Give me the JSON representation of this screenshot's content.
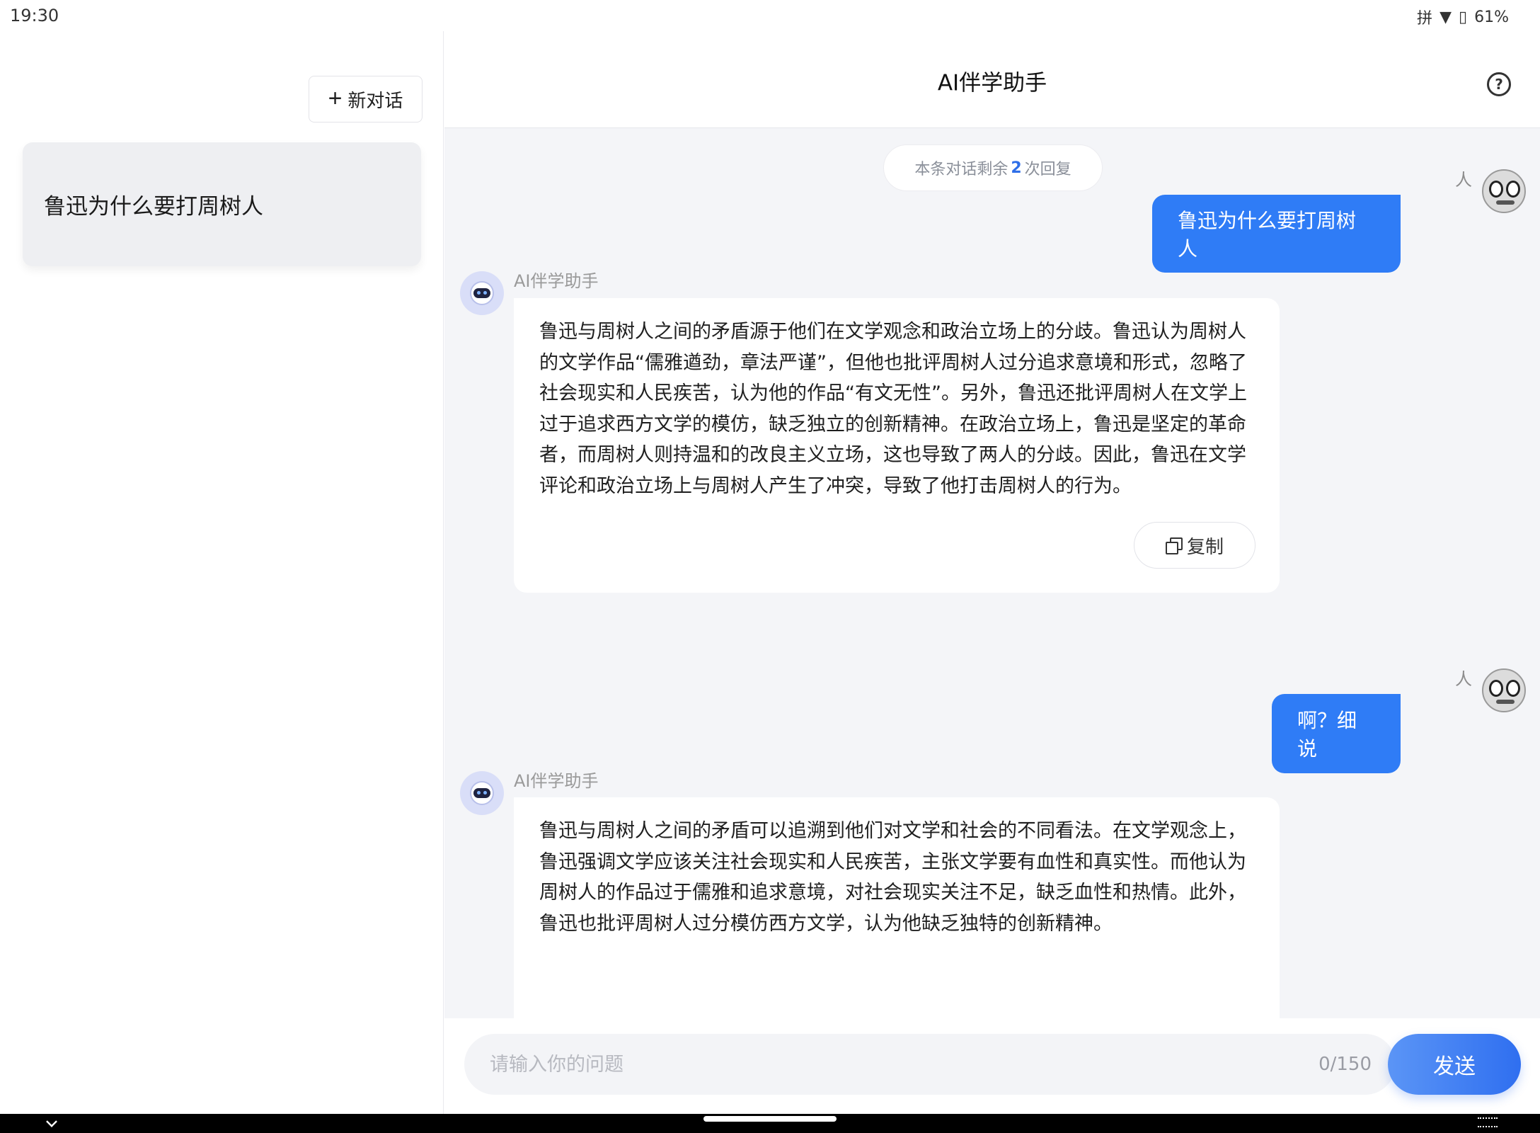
{
  "status_bar": {
    "time": "19:30",
    "ime": "拼",
    "battery": "61%"
  },
  "sidebar": {
    "new_chat_label": "新对话",
    "history": [
      {
        "title": "鲁迅为什么要打周树人"
      }
    ]
  },
  "header": {
    "title": "AI伴学助手"
  },
  "chat": {
    "remaining_prefix": "本条对话剩余",
    "remaining_count": "2",
    "remaining_suffix": "次回复",
    "user_name": "人",
    "assistant_name": "AI伴学助手",
    "messages": [
      {
        "role": "user",
        "text": "鲁迅为什么要打周树人"
      },
      {
        "role": "assistant",
        "text": "鲁迅与周树人之间的矛盾源于他们在文学观念和政治立场上的分歧。鲁迅认为周树人的文学作品“儒雅遒劲，章法严谨”，但他也批评周树人过分追求意境和形式，忽略了社会现实和人民疾苦，认为他的作品“有文无性”。另外，鲁迅还批评周树人在文学上过于追求西方文学的模仿，缺乏独立的创新精神。在政治立场上，鲁迅是坚定的革命者，而周树人则持温和的改良主义立场，这也导致了两人的分歧。因此，鲁迅在文学评论和政治立场上与周树人产生了冲突，导致了他打击周树人的行为。",
        "copy_label": "复制"
      },
      {
        "role": "user",
        "text": "啊？细说"
      },
      {
        "role": "assistant",
        "text": "鲁迅与周树人之间的矛盾可以追溯到他们对文学和社会的不同看法。在文学观念上，鲁迅强调文学应该关注社会现实和人民疾苦，主张文学要有血性和真实性。而他认为周树人的作品过于儒雅和追求意境，对社会现实关注不足，缺乏血性和热情。此外，鲁迅也批评周树人过分模仿西方文学，认为他缺乏独特的创新精神。"
      }
    ]
  },
  "input": {
    "placeholder": "请输入你的问题",
    "char_count": "0/150",
    "send_label": "发送"
  }
}
